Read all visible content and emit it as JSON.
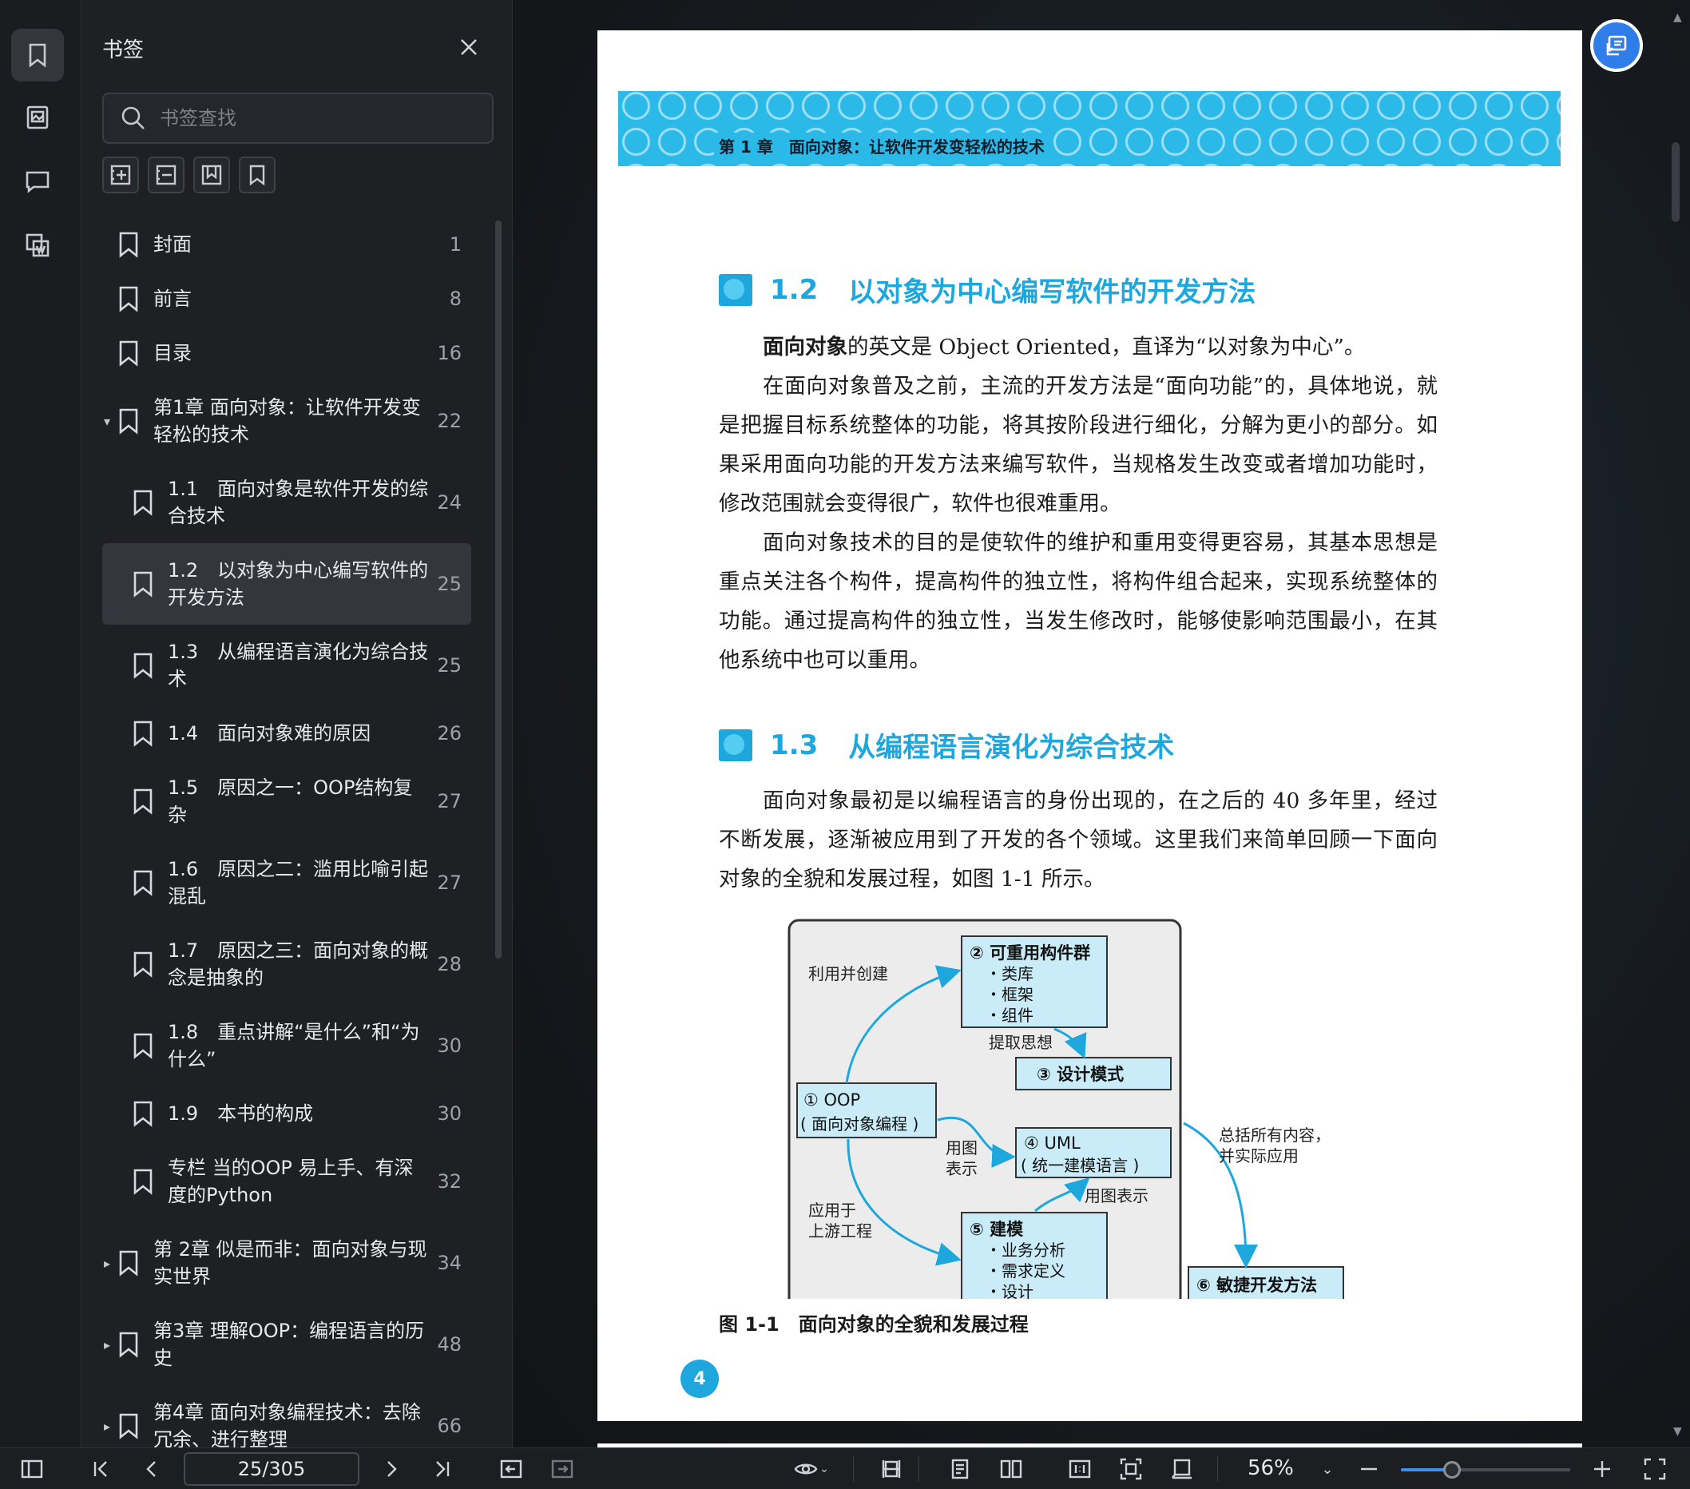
{
  "rail": {
    "items": [
      {
        "name": "bookmark-icon",
        "active": true
      },
      {
        "name": "image-icon",
        "active": false
      },
      {
        "name": "comment-icon",
        "active": false
      },
      {
        "name": "extract-icon",
        "active": false
      }
    ]
  },
  "panel": {
    "title": "书签",
    "search_placeholder": "书签查找",
    "tools": [
      "expand-all-icon",
      "collapse-all-icon",
      "add-bookmark-icon",
      "bookmark-icon"
    ],
    "bookmarks": [
      {
        "label": "封面",
        "page": "1",
        "level": 0,
        "caret": ""
      },
      {
        "label": "前言",
        "page": "8",
        "level": 0,
        "caret": ""
      },
      {
        "label": "目录",
        "page": "16",
        "level": 0,
        "caret": ""
      },
      {
        "label": "第1章 面向对象：让软件开发变轻松的技术",
        "page": "22",
        "level": 0,
        "caret": "▾"
      },
      {
        "label": "1.1　面向对象是软件开发的综合技术",
        "page": "24",
        "level": 1,
        "caret": ""
      },
      {
        "label": "1.2　以对象为中心编写软件的开发方法",
        "page": "25",
        "level": 1,
        "caret": "",
        "active": true
      },
      {
        "label": "1.3　从编程语言演化为综合技术",
        "page": "25",
        "level": 1,
        "caret": ""
      },
      {
        "label": "1.4　面向对象难的原因",
        "page": "26",
        "level": 1,
        "caret": ""
      },
      {
        "label": "1.5　原因之一：OOP结构复杂",
        "page": "27",
        "level": 1,
        "caret": ""
      },
      {
        "label": "1.6　原因之二：滥用比喻引起混乱",
        "page": "27",
        "level": 1,
        "caret": ""
      },
      {
        "label": "1.7　原因之三：面向对象的概念是抽象的",
        "page": "28",
        "level": 1,
        "caret": ""
      },
      {
        "label": "1.8　重点讲解“是什么”和“为什么”",
        "page": "30",
        "level": 1,
        "caret": ""
      },
      {
        "label": "1.9　本书的构成",
        "page": "30",
        "level": 1,
        "caret": ""
      },
      {
        "label": "专栏 当的OOP 易上手、有深度的Python",
        "page": "32",
        "level": 1,
        "caret": ""
      },
      {
        "label": "第 2章 似是而非：面向对象与现实世界",
        "page": "34",
        "level": 0,
        "caret": "▸"
      },
      {
        "label": "第3章 理解OOP：编程语言的历史",
        "page": "48",
        "level": 0,
        "caret": "▸"
      },
      {
        "label": "第4章 面向对象编程技术：去除冗余、进行整理",
        "page": "66",
        "level": 0,
        "caret": "▸"
      }
    ]
  },
  "document": {
    "chapter_banner": "第 1 章　面向对象：让软件开发变轻松的技术",
    "sec1": {
      "num": "1.2",
      "title": "以对象为中心编写软件的开发方法"
    },
    "sec1_p1_bold": "面向对象",
    "sec1_p1_rest": "的英文是 Object Oriented，直译为“以对象为中心”。",
    "sec1_p2": "在面向对象普及之前，主流的开发方法是“面向功能”的，具体地说，就是把握目标系统整体的功能，将其按阶段进行细化，分解为更小的部分。如果采用面向功能的开发方法来编写软件，当规格发生改变或者增加功能时，修改范围就会变得很广，软件也很难重用。",
    "sec1_p3": "面向对象技术的目的是使软件的维护和重用变得更容易，其基本思想是重点关注各个构件，提高构件的独立性，将构件组合起来，实现系统整体的功能。通过提高构件的独立性，当发生修改时，能够使影响范围最小，在其他系统中也可以重用。",
    "sec2": {
      "num": "1.3",
      "title": "从编程语言演化为综合技术"
    },
    "sec2_p1": "面向对象最初是以编程语言的身份出现的，在之后的 40 多年里，经过不断发展，逐渐被应用到了开发的各个领域。这里我们来简单回顾一下面向对象的全貌和发展过程，如图 1-1 所示。",
    "figure": {
      "box2_title": "② 可重用构件群",
      "box2_items": [
        "・类库",
        "・框架",
        "・组件"
      ],
      "box3": "③ 设计模式",
      "box1_line1": "① OOP",
      "box1_line2": "( 面向对象编程 )",
      "box4_line1": "④ UML",
      "box4_line2": "( 统一建模语言 )",
      "box5_title": "⑤ 建模",
      "box5_items": [
        "・业务分析",
        "・需求定义",
        "・设计"
      ],
      "box6": "⑥ 敏捷开发方法",
      "lbl_use_create": "利用并创建",
      "lbl_extract": "提取思想",
      "lbl_diagram1": "用图",
      "lbl_diagram2": "表示",
      "lbl_diagram_repr": "用图表示",
      "lbl_upstream1": "应用于",
      "lbl_upstream2": "上游工程",
      "lbl_summary1": "总括所有内容，",
      "lbl_summary2": "并实际应用"
    },
    "caption": "图 1-1　面向对象的全貌和发展过程",
    "page_number": "4"
  },
  "bottombar": {
    "page_indicator": "25/305",
    "zoom": "56%",
    "zoom_level": 0.3
  },
  "colors": {
    "accent": "#1ea7dd",
    "banner": "#2bb9e8",
    "figure_box": "#c9ecf8",
    "float_button": "#2f7de8"
  }
}
